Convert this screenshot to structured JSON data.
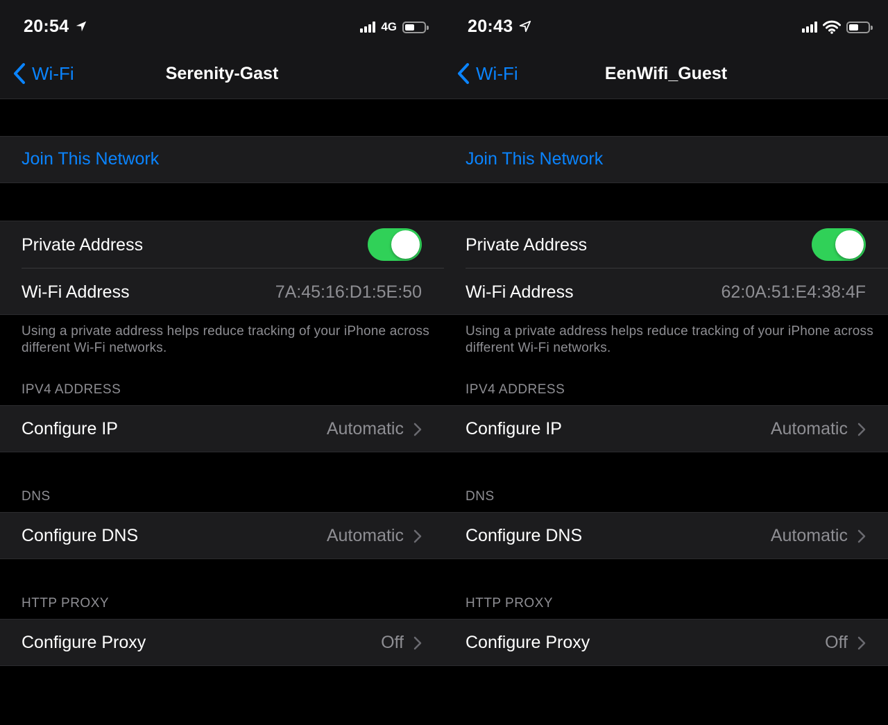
{
  "screens": [
    {
      "status": {
        "time": "20:54",
        "network": "4G",
        "connection": "cellular"
      },
      "nav": {
        "back_label": "Wi-Fi",
        "title": "Serenity-Gast"
      },
      "join_label": "Join This Network",
      "private_address": {
        "label": "Private Address",
        "enabled": true
      },
      "wifi_address": {
        "label": "Wi-Fi Address",
        "value": "7A:45:16:D1:5E:50"
      },
      "footnote": "Using a private address helps reduce tracking of your iPhone across different Wi-Fi networks.",
      "ipv4": {
        "header": "IPV4 ADDRESS",
        "label": "Configure IP",
        "value": "Automatic"
      },
      "dns": {
        "header": "DNS",
        "label": "Configure DNS",
        "value": "Automatic"
      },
      "proxy": {
        "header": "HTTP PROXY",
        "label": "Configure Proxy",
        "value": "Off"
      }
    },
    {
      "status": {
        "time": "20:43",
        "network": "",
        "connection": "wifi"
      },
      "nav": {
        "back_label": "Wi-Fi",
        "title": "EenWifi_Guest"
      },
      "join_label": "Join This Network",
      "private_address": {
        "label": "Private Address",
        "enabled": true
      },
      "wifi_address": {
        "label": "Wi-Fi Address",
        "value": "62:0A:51:E4:38:4F"
      },
      "footnote": "Using a private address helps reduce tracking of your iPhone across different Wi-Fi networks.",
      "ipv4": {
        "header": "IPV4 ADDRESS",
        "label": "Configure IP",
        "value": "Automatic"
      },
      "dns": {
        "header": "DNS",
        "label": "Configure DNS",
        "value": "Automatic"
      },
      "proxy": {
        "header": "HTTP PROXY",
        "label": "Configure Proxy",
        "value": "Off"
      }
    }
  ],
  "colors": {
    "accent": "#0a84ff",
    "toggle_on": "#30d158",
    "secondary_text": "#8e8e93",
    "cell_bg": "#1c1c1e"
  },
  "icons": [
    "location-arrow-icon",
    "cellular-signal-icon",
    "wifi-icon",
    "battery-icon",
    "chevron-left-icon",
    "chevron-right-icon"
  ]
}
